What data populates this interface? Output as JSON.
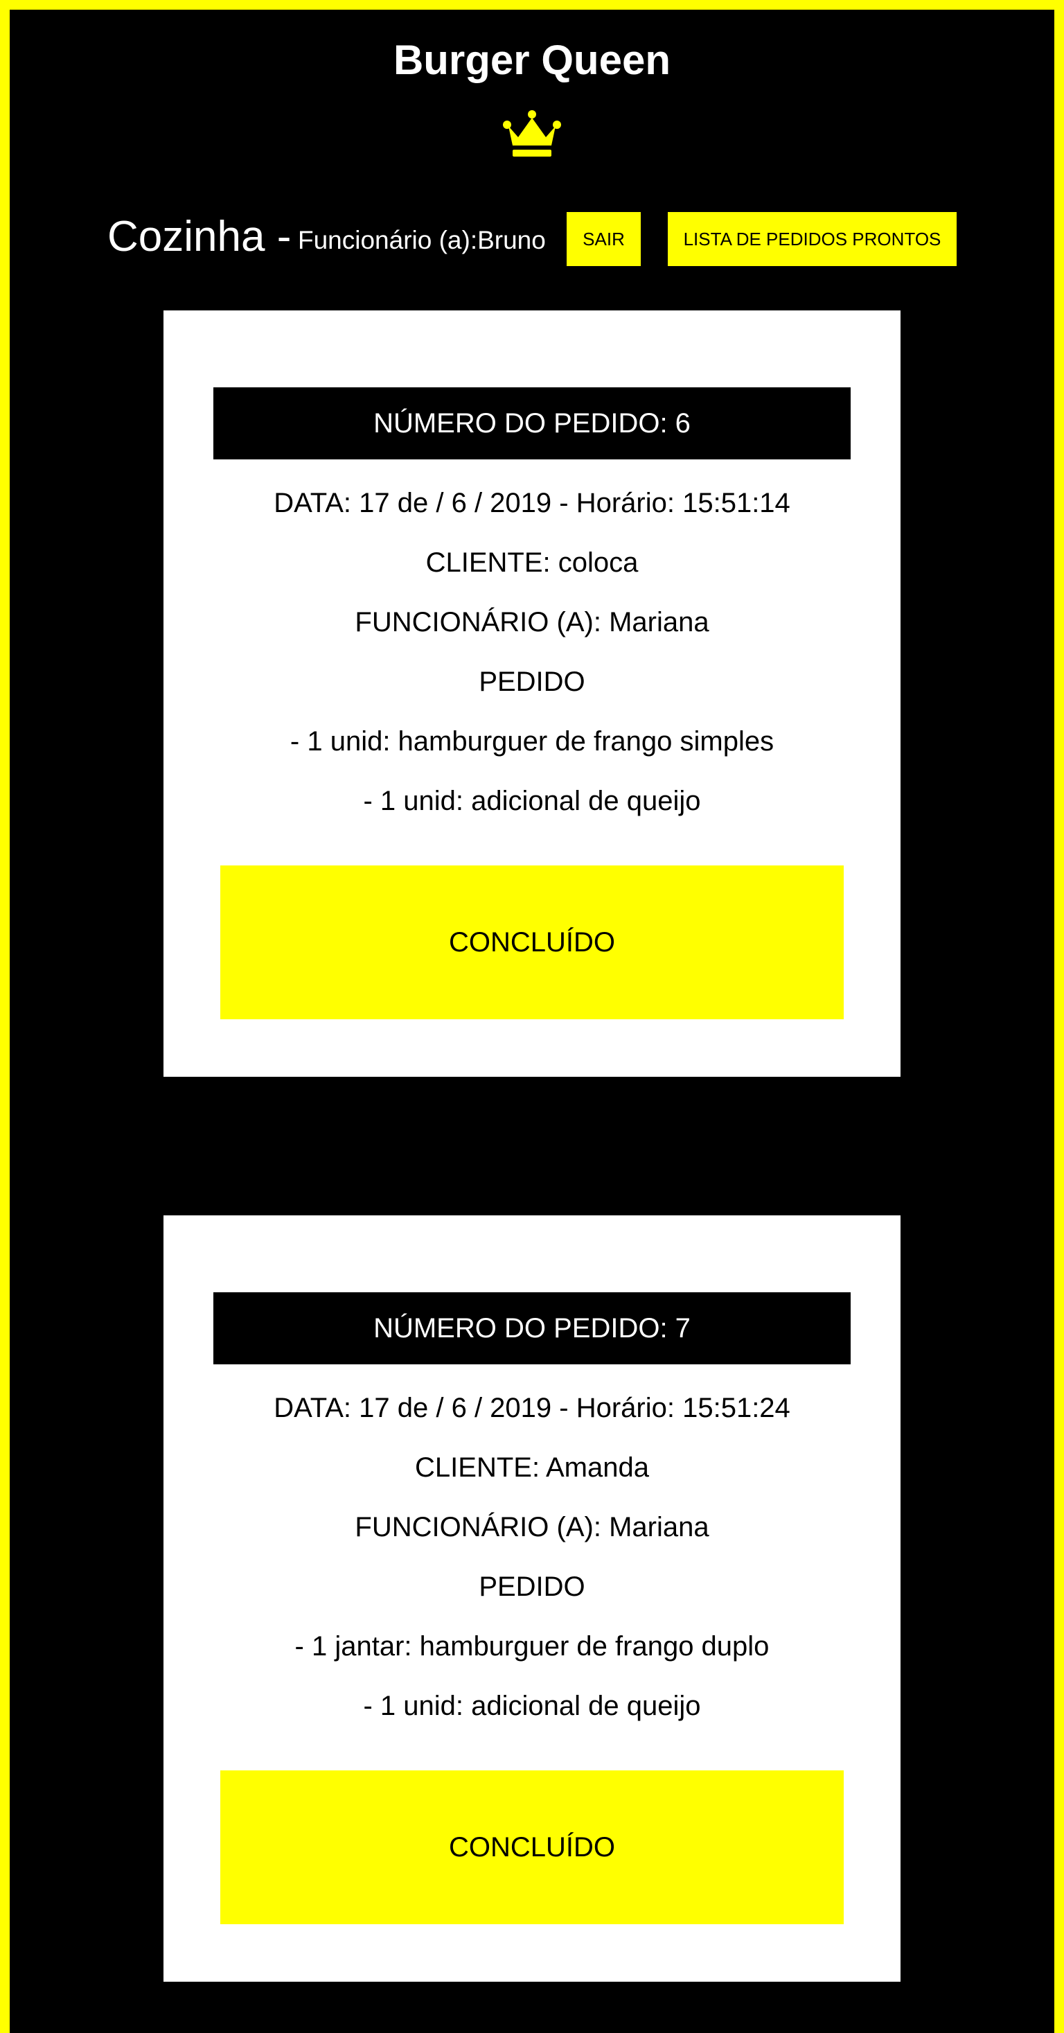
{
  "app": {
    "title": "Burger Queen",
    "crown_icon": "crown-icon",
    "accent_color": "#ffff00",
    "background_color": "#000000"
  },
  "header": {
    "section_title": "Cozinha -",
    "employee_text": "Funcionário (a):Bruno",
    "logout_label": "SAIR",
    "ready_orders_label": "LISTA DE PEDIDOS PRONTOS"
  },
  "orders": [
    {
      "number_label": "NÚMERO DO PEDIDO: 6",
      "date_line": "DATA: 17 de / 6 / 2019 - Horário: 15:51:14",
      "client_line": "CLIENTE: coloca",
      "employee_line": "FUNCIONÁRIO (A): Mariana",
      "order_heading": "PEDIDO",
      "items": [
        "- 1 unid: hamburguer de frango simples",
        "- 1 unid: adicional de queijo"
      ],
      "done_label": "CONCLUÍDO"
    },
    {
      "number_label": "NÚMERO DO PEDIDO: 7",
      "date_line": "DATA: 17 de / 6 / 2019 - Horário: 15:51:24",
      "client_line": "CLIENTE: Amanda",
      "employee_line": "FUNCIONÁRIO (A): Mariana",
      "order_heading": "PEDIDO",
      "items": [
        "- 1 jantar: hamburguer de frango duplo",
        "- 1 unid: adicional de queijo"
      ],
      "done_label": "CONCLUÍDO"
    }
  ]
}
